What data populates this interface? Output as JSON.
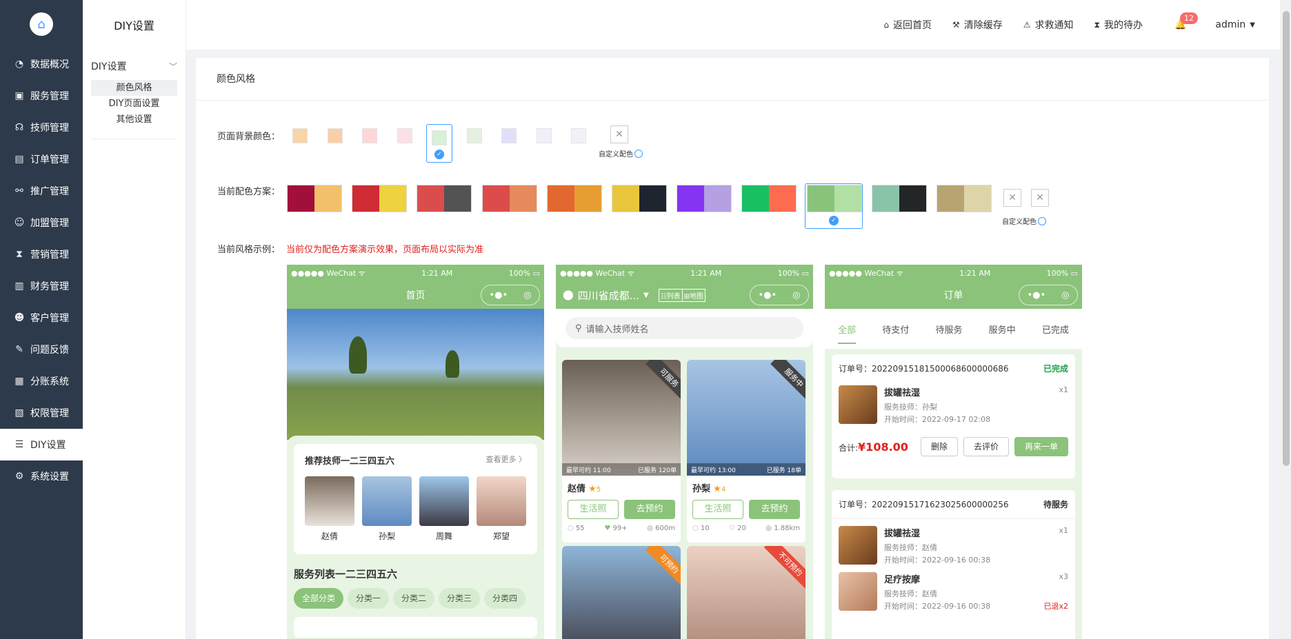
{
  "sidebar": {
    "items": [
      {
        "label": "数据概况",
        "icon": "pie-chart-icon"
      },
      {
        "label": "服务管理",
        "icon": "box-icon"
      },
      {
        "label": "技师管理",
        "icon": "headset-icon"
      },
      {
        "label": "订单管理",
        "icon": "clipboard-icon"
      },
      {
        "label": "推广管理",
        "icon": "network-icon"
      },
      {
        "label": "加盟管理",
        "icon": "user-add-icon"
      },
      {
        "label": "营销管理",
        "icon": "hourglass-icon"
      },
      {
        "label": "财务管理",
        "icon": "wallet-icon"
      },
      {
        "label": "客户管理",
        "icon": "users-icon"
      },
      {
        "label": "问题反馈",
        "icon": "edit-icon"
      },
      {
        "label": "分账系统",
        "icon": "bar-chart-icon"
      },
      {
        "label": "权限管理",
        "icon": "key-icon"
      },
      {
        "label": "DIY设置",
        "icon": "layers-icon"
      },
      {
        "label": "系统设置",
        "icon": "gear-icon"
      }
    ]
  },
  "subsidebar": {
    "title": "DIY设置",
    "group": "DIY设置",
    "items": [
      "颜色风格",
      "DIY页面设置",
      "其他设置"
    ]
  },
  "header": {
    "home": "返回首页",
    "clear_cache": "清除缓存",
    "sos": "求救通知",
    "todo": "我的待办",
    "badge": "12",
    "user": "admin"
  },
  "panel": {
    "title": "颜色风格",
    "bg_label": "页面背景颜色：",
    "scheme_label": "当前配色方案：",
    "example_label": "当前风格示例：",
    "example_hint": "当前仅为配色方案演示效果，页面布局以实际为准",
    "custom_label": "自定义配色",
    "bg_colors": [
      "#f8d4a8",
      "#f9cfa8",
      "#fdd8d6",
      "#fde0e6",
      "#d8f0d8",
      "#e4f0e0",
      "#e0e0fa",
      "#f0f0fa",
      "#f0f2f8"
    ],
    "schemes": [
      [
        "#a10f3a",
        "#f2c06a"
      ],
      [
        "#cf2b35",
        "#efd23f"
      ],
      [
        "#db4d4c",
        "#535353"
      ],
      [
        "#dc4c4b",
        "#e68a5b"
      ],
      [
        "#e26830",
        "#e69d32"
      ],
      [
        "#e8c73d",
        "#1e252f"
      ],
      [
        "#8534f2",
        "#b4a0e3"
      ],
      [
        "#19c062",
        "#fd6c4e"
      ],
      [
        "#87c47a",
        "#b1dfa4"
      ],
      [
        "#8ac4a8",
        "#232626"
      ],
      [
        "#b8a470",
        "#ddd5a8"
      ]
    ]
  },
  "phone1": {
    "carrier": "●●●●● WeChat ᯤ",
    "time": "1:21 AM",
    "battery": "100%",
    "title": "首页",
    "rec_title": "推荐技师一二三四五六",
    "see_more": "查看更多 〉",
    "techs": [
      "赵倩",
      "孙梨",
      "周舞",
      "郑望"
    ],
    "service_title": "服务列表一二三四五六",
    "categories": [
      "全部分类",
      "分类一",
      "分类二",
      "分类三",
      "分类四"
    ]
  },
  "phone2": {
    "location": "四川省成都...",
    "list_btn": "☷列表",
    "map_btn": "⊞地图",
    "search_placeholder": "请输入技师姓名",
    "cards": [
      {
        "ribbon": "可服务",
        "foot_left": "最早可约 11:00",
        "foot_right": "已服务 120单",
        "name": "赵倩",
        "stars": "5",
        "comments": "55",
        "likes": "99+",
        "distance": "600m"
      },
      {
        "ribbon": "服务中",
        "foot_left": "最早可约 13:00",
        "foot_right": "已服务 18单",
        "name": "孙梨",
        "stars": "4",
        "comments": "10",
        "likes": "20",
        "distance": "1.88km"
      },
      {
        "ribbon": "可预约"
      },
      {
        "ribbon": "不可预约"
      }
    ],
    "btn_life": "生活照",
    "btn_book": "去预约"
  },
  "phone3": {
    "title": "订单",
    "tabs": [
      "全部",
      "待支付",
      "待服务",
      "服务中",
      "已完成"
    ],
    "order1": {
      "no": "订单号：20220915181500068600000686",
      "status": "已完成",
      "item": "拔罐祛湿",
      "qty": "x1",
      "tech": "服务技师：孙梨",
      "start": "开始时间：2022-09-17 02:08",
      "total_label": "合计:",
      "total": "¥108.00",
      "btn_del": "删除",
      "btn_rate": "去评价",
      "btn_again": "再来一单"
    },
    "order2": {
      "no": "订单号：20220915171623025600000256",
      "status": "待服务",
      "item1": "拔罐祛湿",
      "qty1": "x1",
      "tech1": "服务技师：赵倩",
      "start1": "开始时间：2022-09-16 00:38",
      "item2": "足疗按摩",
      "qty2": "x3",
      "tech2": "服务技师：赵倩",
      "start2": "开始时间：2022-09-16 00:38",
      "refund": "已退x2"
    }
  }
}
